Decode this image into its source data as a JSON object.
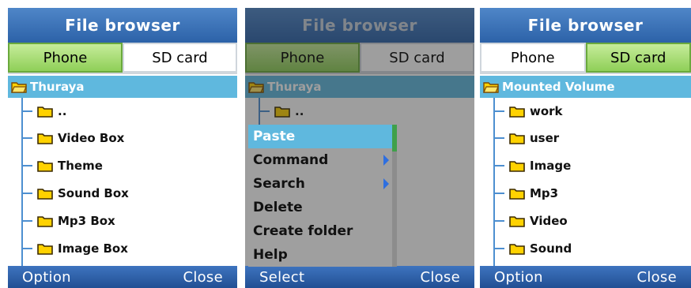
{
  "colors": {
    "title_bar": "#3566ae",
    "tab_active": "#9cd86a",
    "selection": "#5fb8de",
    "folder_fill": "#ffd200",
    "tree_line": "#4d8fd0",
    "softkey_bar": "#2c5da3"
  },
  "screens": [
    {
      "title": "File browser",
      "tabs": [
        {
          "label": "Phone",
          "active": true
        },
        {
          "label": "SD card",
          "active": false
        }
      ],
      "root": "Thuraya",
      "items": [
        "..",
        "Video Box",
        "Theme",
        "Sound Box",
        "Mp3 Box",
        "Image Box"
      ],
      "softkeys": {
        "left": "Option",
        "right": "Close"
      }
    },
    {
      "title": "File browser",
      "tabs": [
        {
          "label": "Phone",
          "active": true
        },
        {
          "label": "SD card",
          "active": false
        }
      ],
      "root": "Thuraya",
      "items": [
        ".."
      ],
      "menu": [
        {
          "label": "Paste",
          "submenu": false
        },
        {
          "label": "Command",
          "submenu": true
        },
        {
          "label": "Search",
          "submenu": true
        },
        {
          "label": "Delete",
          "submenu": false
        },
        {
          "label": "Create folder",
          "submenu": false
        },
        {
          "label": "Help",
          "submenu": false
        }
      ],
      "softkeys": {
        "left": "Select",
        "right": "Close"
      }
    },
    {
      "title": "File browser",
      "tabs": [
        {
          "label": "Phone",
          "active": false
        },
        {
          "label": "SD card",
          "active": true
        }
      ],
      "root": "Mounted Volume",
      "items": [
        "work",
        "user",
        "Image",
        "Mp3",
        "Video",
        "Sound"
      ],
      "softkeys": {
        "left": "Option",
        "right": "Close"
      }
    }
  ]
}
